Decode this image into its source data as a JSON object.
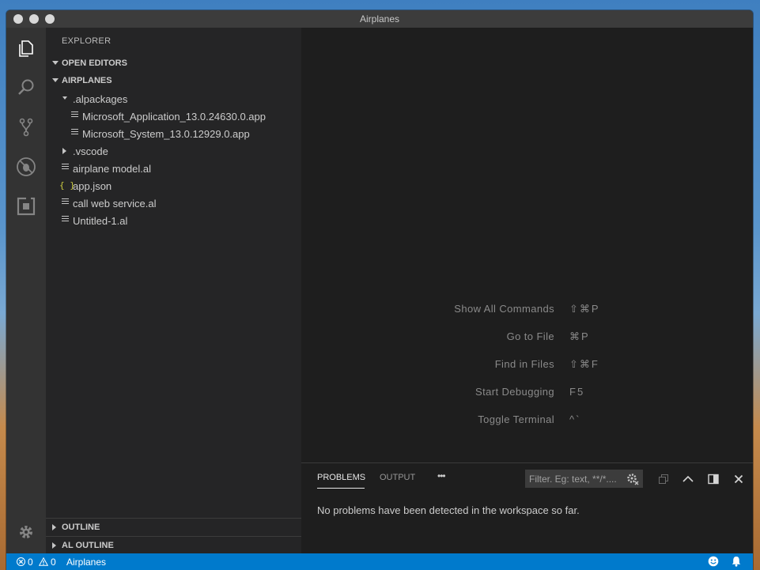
{
  "window": {
    "title": "Airplanes"
  },
  "sidebar": {
    "title": "EXPLORER",
    "sections": {
      "open_editors": "OPEN EDITORS",
      "workspace": "AIRPLANES",
      "outline": "OUTLINE",
      "al_outline": "AL OUTLINE"
    },
    "tree": [
      {
        "label": ".alpackages",
        "icon": "chevron-down-icon"
      },
      {
        "label": "Microsoft_Application_13.0.24630.0.app",
        "icon": "file-lines-icon"
      },
      {
        "label": "Microsoft_System_13.0.12929.0.app",
        "icon": "file-lines-icon"
      },
      {
        "label": ".vscode",
        "icon": "chevron-right-icon"
      },
      {
        "label": "airplane model.al",
        "icon": "file-lines-icon"
      },
      {
        "label": "app.json",
        "icon": "json-braces-icon",
        "icon_glyph": "{ }"
      },
      {
        "label": "call web service.al",
        "icon": "file-lines-icon"
      },
      {
        "label": "Untitled-1.al",
        "icon": "file-lines-icon"
      }
    ]
  },
  "editor": {
    "watermark": [
      {
        "label": "Show All Commands",
        "keys": "⇧⌘P"
      },
      {
        "label": "Go to File",
        "keys": "⌘P"
      },
      {
        "label": "Find in Files",
        "keys": "⇧⌘F"
      },
      {
        "label": "Start Debugging",
        "keys": "F5"
      },
      {
        "label": "Toggle Terminal",
        "keys": "^`"
      }
    ]
  },
  "panel": {
    "tabs": [
      "PROBLEMS",
      "OUTPUT"
    ],
    "more": "•••",
    "filter_placeholder": "Filter. Eg: text, **/*....",
    "message": "No problems have been detected in the workspace so far."
  },
  "statusbar": {
    "errors": "0",
    "warnings": "0",
    "folder": "Airplanes"
  },
  "colors": {
    "statusbar": "#007acc",
    "activitybar": "#333333",
    "sidebar": "#252526",
    "editor": "#1e1e1e"
  }
}
